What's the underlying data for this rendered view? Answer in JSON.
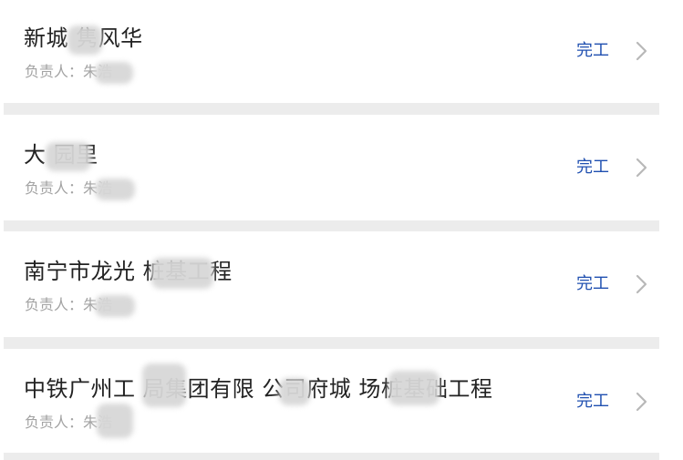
{
  "colors": {
    "title": "#222222",
    "owner": "#a3a3a3",
    "status": "#1f4fb0",
    "separator": "#ececec",
    "chevron": "#b8b8b8"
  },
  "projects": [
    {
      "title": "新城 隽风华",
      "owner_prefix": "负责人：",
      "owner_name": "朱浩",
      "status": "完工",
      "action_icon": "chevron-right-icon"
    },
    {
      "title": "大 园里",
      "owner_prefix": "负责人：",
      "owner_name": "朱浩",
      "status": "完工",
      "action_icon": "chevron-right-icon"
    },
    {
      "title": "南宁市龙光 桩基工程",
      "owner_prefix": "负责人：",
      "owner_name": "朱浩",
      "status": "完工",
      "action_icon": "chevron-right-icon"
    },
    {
      "title": "中铁广州工 局集团有限 公司府城 场桩基础工程",
      "owner_prefix": "负责人：",
      "owner_name": "朱浩",
      "status": "完工",
      "action_icon": "chevron-right-icon"
    }
  ]
}
